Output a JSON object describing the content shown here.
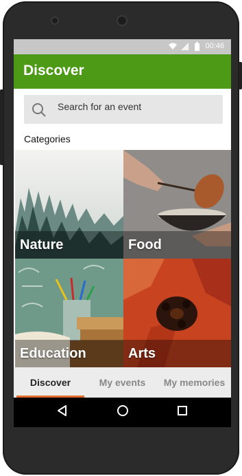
{
  "status_bar": {
    "time": "00:46"
  },
  "app_bar": {
    "title": "Discover"
  },
  "search": {
    "placeholder": "Search for an event"
  },
  "categories": {
    "heading": "Categories",
    "items": [
      {
        "label": "Nature"
      },
      {
        "label": "Food"
      },
      {
        "label": "Education"
      },
      {
        "label": "Arts"
      }
    ]
  },
  "tabs": [
    {
      "label": "Discover",
      "active": true
    },
    {
      "label": "My events",
      "active": false
    },
    {
      "label": "My memories",
      "active": false
    }
  ],
  "colors": {
    "app_bar": "#4c9a16",
    "tab_indicator": "#e06b2c"
  },
  "nav_icons": [
    "back-icon",
    "home-icon",
    "recents-icon"
  ]
}
